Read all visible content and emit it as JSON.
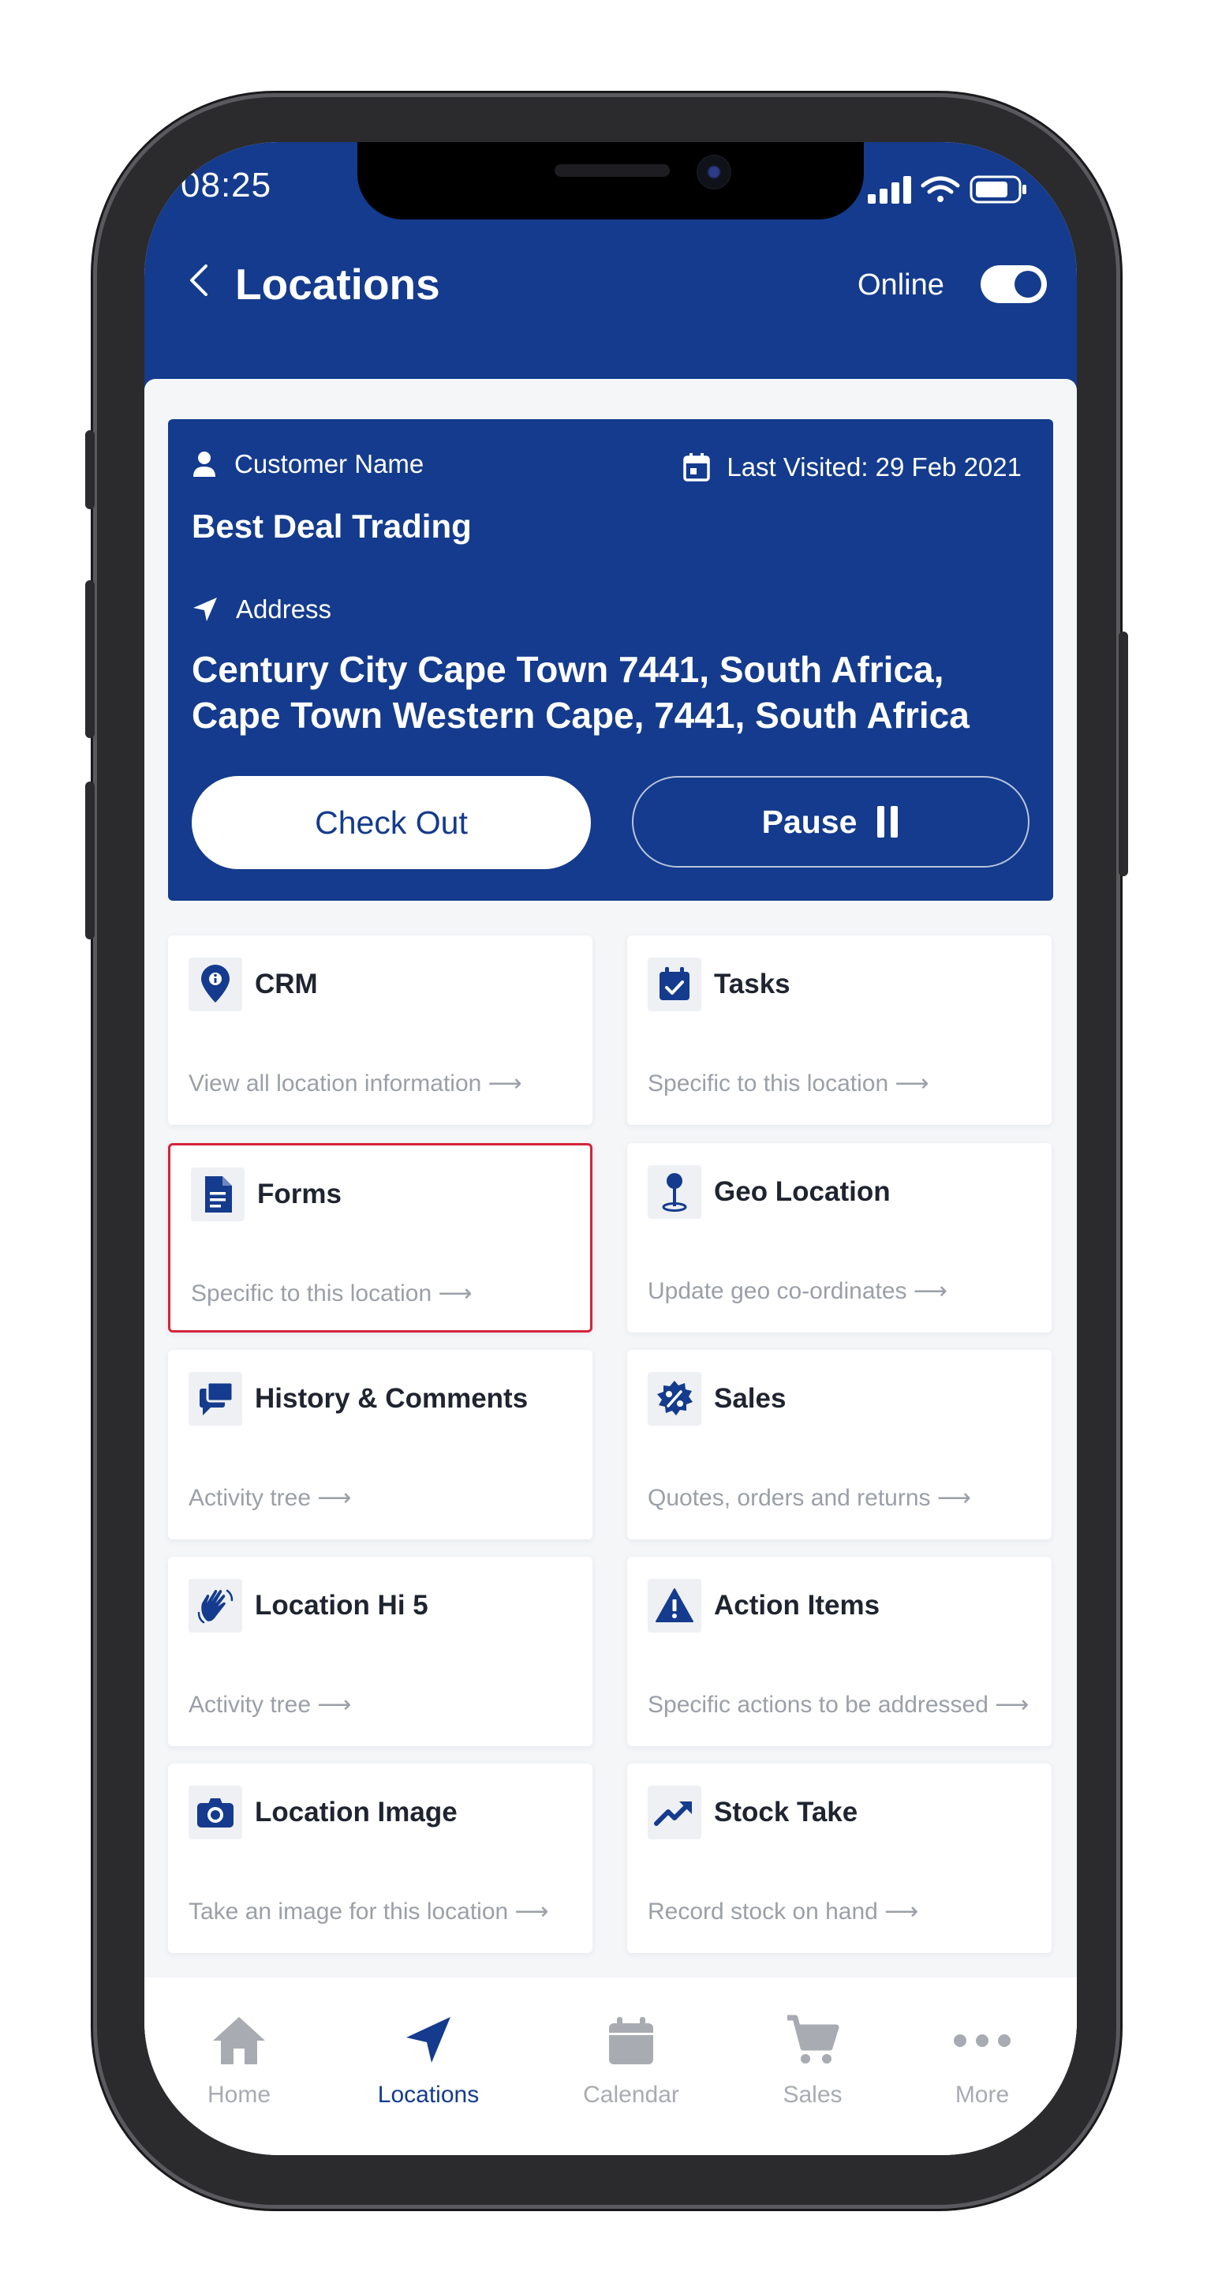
{
  "status_bar": {
    "time": "08:25"
  },
  "header": {
    "title": "Locations",
    "online_label": "Online",
    "online_enabled": true,
    "accent_color": "#143b8d"
  },
  "customer": {
    "name_label": "Customer Name",
    "name": "Best Deal Trading",
    "last_visited": "Last Visited: 29 Feb 2021",
    "address_label": "Address",
    "address": "Century City Cape Town 7441, South Africa, Cape Town Western Cape, 7441, South Africa",
    "checkout_label": "Check Out",
    "pause_label": "Pause"
  },
  "tiles": [
    {
      "title": "CRM",
      "subtitle": "View all location information ⟶",
      "icon": "location-info-icon"
    },
    {
      "title": "Tasks",
      "subtitle": "Specific to this location  ⟶",
      "icon": "calendar-check-icon"
    },
    {
      "title": "Forms",
      "subtitle": "Specific to this location ⟶",
      "icon": "document-icon",
      "selected": true
    },
    {
      "title": "Geo Location",
      "subtitle": "Update geo co-ordinates ⟶",
      "icon": "map-pin-icon"
    },
    {
      "title": "History & Comments",
      "subtitle": "Activity tree  ⟶",
      "icon": "comments-icon"
    },
    {
      "title": "Sales",
      "subtitle": "Quotes, orders and returns ⟶",
      "icon": "discount-badge-icon"
    },
    {
      "title": "Location Hi 5",
      "subtitle": "Activity tree  ⟶",
      "icon": "waving-hand-icon"
    },
    {
      "title": "Action Items",
      "subtitle": "Specific actions to be addressed ⟶",
      "icon": "warning-icon"
    },
    {
      "title": "Location Image",
      "subtitle": "Take an image for this location ⟶",
      "icon": "camera-icon"
    },
    {
      "title": "Stock Take",
      "subtitle": "Record stock on hand ⟶",
      "icon": "trending-up-icon"
    }
  ],
  "bottom_nav": [
    {
      "label": "Home",
      "icon": "home-icon"
    },
    {
      "label": "Locations",
      "icon": "navigation-arrow-icon",
      "active": true
    },
    {
      "label": "Calendar",
      "icon": "calendar-icon"
    },
    {
      "label": "Sales",
      "icon": "cart-icon"
    },
    {
      "label": "More",
      "icon": "more-dots-icon"
    }
  ]
}
